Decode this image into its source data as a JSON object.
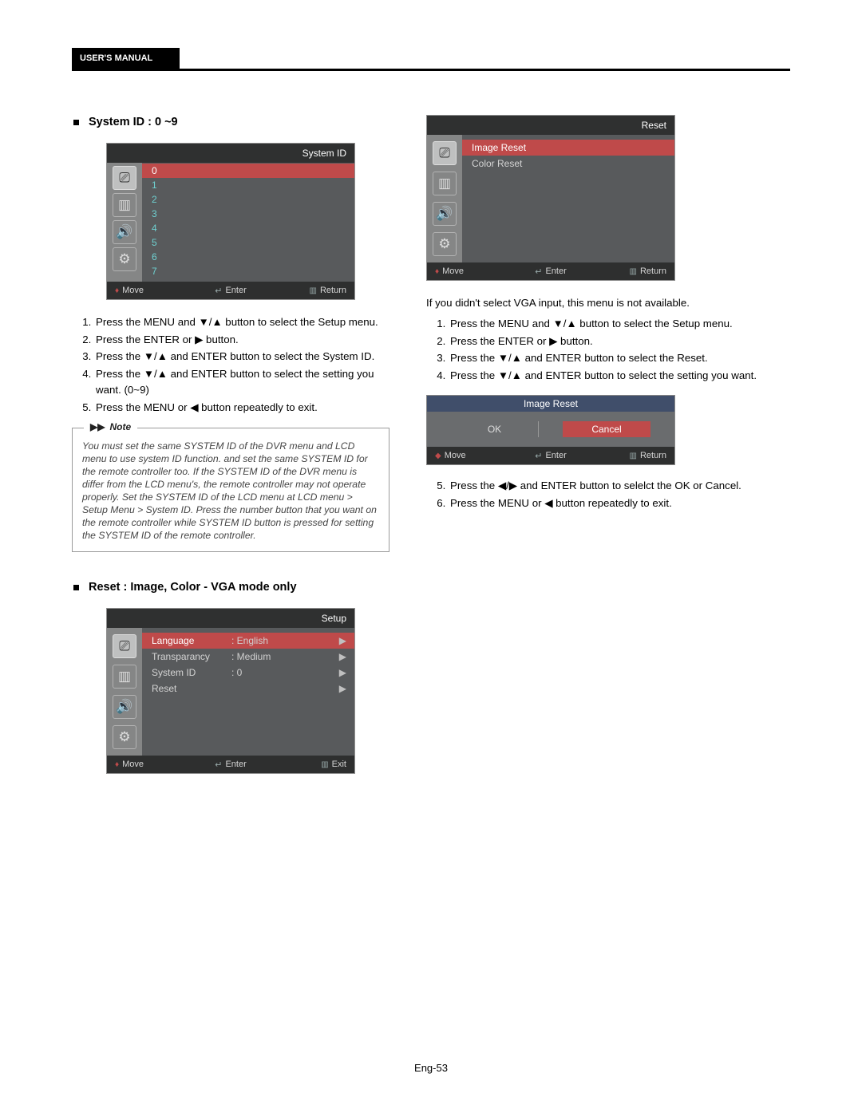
{
  "header": {
    "tab": "USER'S MANUAL"
  },
  "page_number": "Eng-53",
  "section1": {
    "title": "System ID : 0 ~9"
  },
  "osd_system_id": {
    "title": "System ID",
    "values": [
      "0",
      "1",
      "2",
      "3",
      "4",
      "5",
      "6",
      "7"
    ],
    "foot": {
      "move": "Move",
      "enter": "Enter",
      "return": "Return"
    }
  },
  "steps_system_id": [
    "Press the MENU and ▼/▲ button to select the Setup menu.",
    "Press the ENTER or ▶ button.",
    "Press the ▼/▲ and ENTER button to select the System ID.",
    "Press the ▼/▲ and ENTER button to select the setting you want. (0~9)",
    "Press the MENU or ◀ button repeatedly to exit."
  ],
  "note": {
    "label": "Note",
    "text": "You must set the same SYSTEM ID of the DVR menu and LCD menu to use system ID function. and set the same SYSTEM ID for the remote controller too. If the SYSTEM ID of the DVR menu is differ from the LCD menu's, the remote controller may not operate properly. Set the SYSTEM ID of the LCD menu at LCD menu > Setup Menu > System ID. Press the number button that you want on the remote controller while SYSTEM ID button is pressed for setting the SYSTEM ID of the remote controller."
  },
  "section2": {
    "title": "Reset : Image, Color - VGA mode only"
  },
  "osd_setup": {
    "title": "Setup",
    "rows": [
      {
        "label": "Language",
        "value": ": English"
      },
      {
        "label": "Transparancy",
        "value": ": Medium"
      },
      {
        "label": "System ID",
        "value": ": 0"
      },
      {
        "label": "Reset",
        "value": ""
      }
    ],
    "foot": {
      "move": "Move",
      "enter": "Enter",
      "exit": "Exit"
    }
  },
  "osd_reset": {
    "title": "Reset",
    "rows": [
      "Image Reset",
      "Color Reset"
    ],
    "foot": {
      "move": "Move",
      "enter": "Enter",
      "return": "Return"
    }
  },
  "reset_unavail": "If you didn't select VGA input, this menu is not available.",
  "steps_reset_a": [
    "Press the MENU and ▼/▲ button to select the Setup menu.",
    "Press the ENTER or ▶ button.",
    "Press the ▼/▲ and ENTER button to select the Reset.",
    "Press the ▼/▲ and ENTER button to select the setting you want."
  ],
  "osd_confirm": {
    "title": "Image Reset",
    "ok": "OK",
    "cancel": "Cancel",
    "foot": {
      "move": "Move",
      "enter": "Enter",
      "return": "Return"
    }
  },
  "steps_reset_b": [
    "Press the ◀/▶ and ENTER button to selelct the OK or Cancel.",
    "Press the MENU or ◀ button repeatedly to exit."
  ]
}
